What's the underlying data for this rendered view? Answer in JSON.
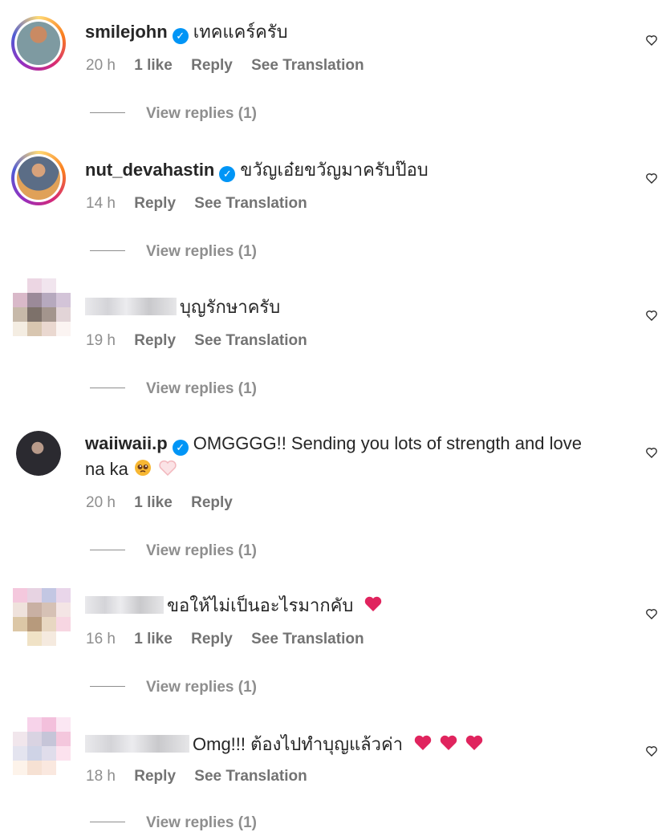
{
  "comments": [
    {
      "username": "smilejohn",
      "verified": true,
      "text": "เทคแคร์ครับ",
      "time": "20 h",
      "likes": "1 like",
      "reply": "Reply",
      "translate": "See Translation",
      "view_replies": "View replies (1)"
    },
    {
      "username": "nut_devahastin",
      "verified": true,
      "text": "ขวัญเอ๋ยขวัญมาครับป๊อบ",
      "time": "14 h",
      "reply": "Reply",
      "translate": "See Translation",
      "view_replies": "View replies (1)"
    },
    {
      "username": "",
      "verified": false,
      "text": "บุญรักษาครับ",
      "time": "19 h",
      "reply": "Reply",
      "translate": "See Translation",
      "view_replies": "View replies (1)"
    },
    {
      "username": "waiiwaii.p",
      "verified": true,
      "text": "OMGGGG!! Sending you lots of strength and love",
      "text2": "na ka",
      "time": "20 h",
      "likes": "1 like",
      "reply": "Reply",
      "view_replies": "View replies (1)"
    },
    {
      "username": "",
      "verified": false,
      "text": "ขอให้ไม่เป็นอะไรมากคับ",
      "time": "16 h",
      "likes": "1 like",
      "reply": "Reply",
      "translate": "See Translation",
      "view_replies": "View replies (1)"
    },
    {
      "username": "",
      "verified": false,
      "text": "Omg!!! ต้องไปทำบุญแล้วค่า",
      "time": "18 h",
      "reply": "Reply",
      "translate": "See Translation",
      "view_replies": "View replies (1)"
    }
  ],
  "icons": {
    "verified": "✓",
    "heart": "heart-outline-icon"
  },
  "colors": {
    "verified_blue": "#0095f6",
    "meta_gray": "#8e8e8e",
    "emoji_heart": "#e0245e"
  }
}
